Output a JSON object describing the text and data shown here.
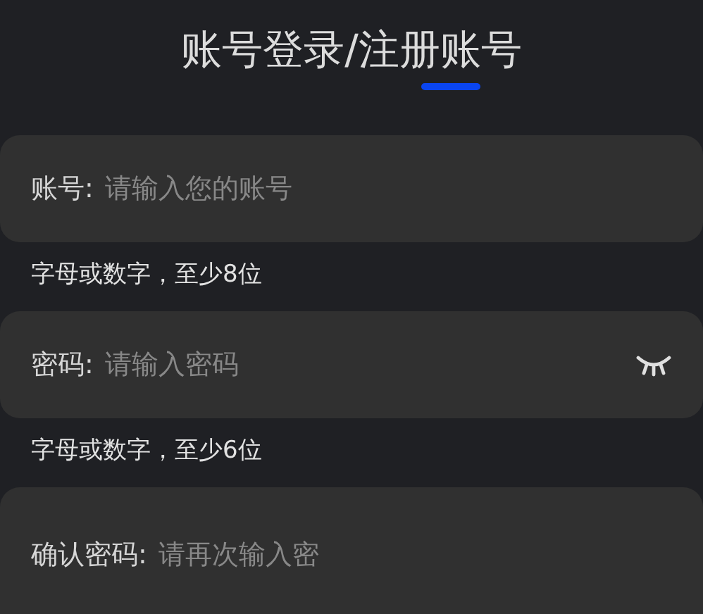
{
  "title": "账号登录/注册账号",
  "fields": [
    {
      "kind": "text",
      "label": "账号:",
      "placeholder": "请输入您的账号",
      "hint": "字母或数字，至少8位"
    },
    {
      "kind": "password",
      "label": "密码:",
      "placeholder": "请输入密码",
      "visible": false,
      "hint": "字母或数字，至少6位"
    },
    {
      "kind": "text",
      "label": "确认密码:",
      "placeholder": "请再次输入密"
    }
  ]
}
